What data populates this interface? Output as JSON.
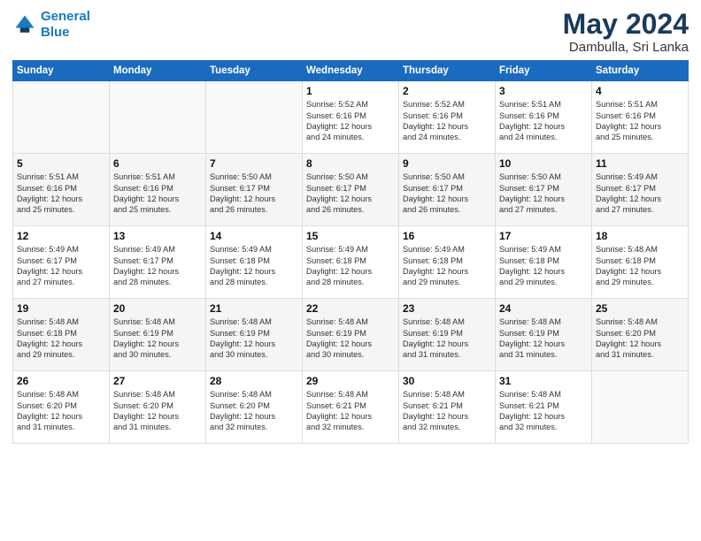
{
  "header": {
    "logo_line1": "General",
    "logo_line2": "Blue",
    "month": "May 2024",
    "location": "Dambulla, Sri Lanka"
  },
  "days_of_week": [
    "Sunday",
    "Monday",
    "Tuesday",
    "Wednesday",
    "Thursday",
    "Friday",
    "Saturday"
  ],
  "weeks": [
    [
      {
        "day": "",
        "content": ""
      },
      {
        "day": "",
        "content": ""
      },
      {
        "day": "",
        "content": ""
      },
      {
        "day": "1",
        "content": "Sunrise: 5:52 AM\nSunset: 6:16 PM\nDaylight: 12 hours\nand 24 minutes."
      },
      {
        "day": "2",
        "content": "Sunrise: 5:52 AM\nSunset: 6:16 PM\nDaylight: 12 hours\nand 24 minutes."
      },
      {
        "day": "3",
        "content": "Sunrise: 5:51 AM\nSunset: 6:16 PM\nDaylight: 12 hours\nand 24 minutes."
      },
      {
        "day": "4",
        "content": "Sunrise: 5:51 AM\nSunset: 6:16 PM\nDaylight: 12 hours\nand 25 minutes."
      }
    ],
    [
      {
        "day": "5",
        "content": "Sunrise: 5:51 AM\nSunset: 6:16 PM\nDaylight: 12 hours\nand 25 minutes."
      },
      {
        "day": "6",
        "content": "Sunrise: 5:51 AM\nSunset: 6:16 PM\nDaylight: 12 hours\nand 25 minutes."
      },
      {
        "day": "7",
        "content": "Sunrise: 5:50 AM\nSunset: 6:17 PM\nDaylight: 12 hours\nand 26 minutes."
      },
      {
        "day": "8",
        "content": "Sunrise: 5:50 AM\nSunset: 6:17 PM\nDaylight: 12 hours\nand 26 minutes."
      },
      {
        "day": "9",
        "content": "Sunrise: 5:50 AM\nSunset: 6:17 PM\nDaylight: 12 hours\nand 26 minutes."
      },
      {
        "day": "10",
        "content": "Sunrise: 5:50 AM\nSunset: 6:17 PM\nDaylight: 12 hours\nand 27 minutes."
      },
      {
        "day": "11",
        "content": "Sunrise: 5:49 AM\nSunset: 6:17 PM\nDaylight: 12 hours\nand 27 minutes."
      }
    ],
    [
      {
        "day": "12",
        "content": "Sunrise: 5:49 AM\nSunset: 6:17 PM\nDaylight: 12 hours\nand 27 minutes."
      },
      {
        "day": "13",
        "content": "Sunrise: 5:49 AM\nSunset: 6:17 PM\nDaylight: 12 hours\nand 28 minutes."
      },
      {
        "day": "14",
        "content": "Sunrise: 5:49 AM\nSunset: 6:18 PM\nDaylight: 12 hours\nand 28 minutes."
      },
      {
        "day": "15",
        "content": "Sunrise: 5:49 AM\nSunset: 6:18 PM\nDaylight: 12 hours\nand 28 minutes."
      },
      {
        "day": "16",
        "content": "Sunrise: 5:49 AM\nSunset: 6:18 PM\nDaylight: 12 hours\nand 29 minutes."
      },
      {
        "day": "17",
        "content": "Sunrise: 5:49 AM\nSunset: 6:18 PM\nDaylight: 12 hours\nand 29 minutes."
      },
      {
        "day": "18",
        "content": "Sunrise: 5:48 AM\nSunset: 6:18 PM\nDaylight: 12 hours\nand 29 minutes."
      }
    ],
    [
      {
        "day": "19",
        "content": "Sunrise: 5:48 AM\nSunset: 6:18 PM\nDaylight: 12 hours\nand 29 minutes."
      },
      {
        "day": "20",
        "content": "Sunrise: 5:48 AM\nSunset: 6:19 PM\nDaylight: 12 hours\nand 30 minutes."
      },
      {
        "day": "21",
        "content": "Sunrise: 5:48 AM\nSunset: 6:19 PM\nDaylight: 12 hours\nand 30 minutes."
      },
      {
        "day": "22",
        "content": "Sunrise: 5:48 AM\nSunset: 6:19 PM\nDaylight: 12 hours\nand 30 minutes."
      },
      {
        "day": "23",
        "content": "Sunrise: 5:48 AM\nSunset: 6:19 PM\nDaylight: 12 hours\nand 31 minutes."
      },
      {
        "day": "24",
        "content": "Sunrise: 5:48 AM\nSunset: 6:19 PM\nDaylight: 12 hours\nand 31 minutes."
      },
      {
        "day": "25",
        "content": "Sunrise: 5:48 AM\nSunset: 6:20 PM\nDaylight: 12 hours\nand 31 minutes."
      }
    ],
    [
      {
        "day": "26",
        "content": "Sunrise: 5:48 AM\nSunset: 6:20 PM\nDaylight: 12 hours\nand 31 minutes."
      },
      {
        "day": "27",
        "content": "Sunrise: 5:48 AM\nSunset: 6:20 PM\nDaylight: 12 hours\nand 31 minutes."
      },
      {
        "day": "28",
        "content": "Sunrise: 5:48 AM\nSunset: 6:20 PM\nDaylight: 12 hours\nand 32 minutes."
      },
      {
        "day": "29",
        "content": "Sunrise: 5:48 AM\nSunset: 6:21 PM\nDaylight: 12 hours\nand 32 minutes."
      },
      {
        "day": "30",
        "content": "Sunrise: 5:48 AM\nSunset: 6:21 PM\nDaylight: 12 hours\nand 32 minutes."
      },
      {
        "day": "31",
        "content": "Sunrise: 5:48 AM\nSunset: 6:21 PM\nDaylight: 12 hours\nand 32 minutes."
      },
      {
        "day": "",
        "content": ""
      }
    ]
  ]
}
